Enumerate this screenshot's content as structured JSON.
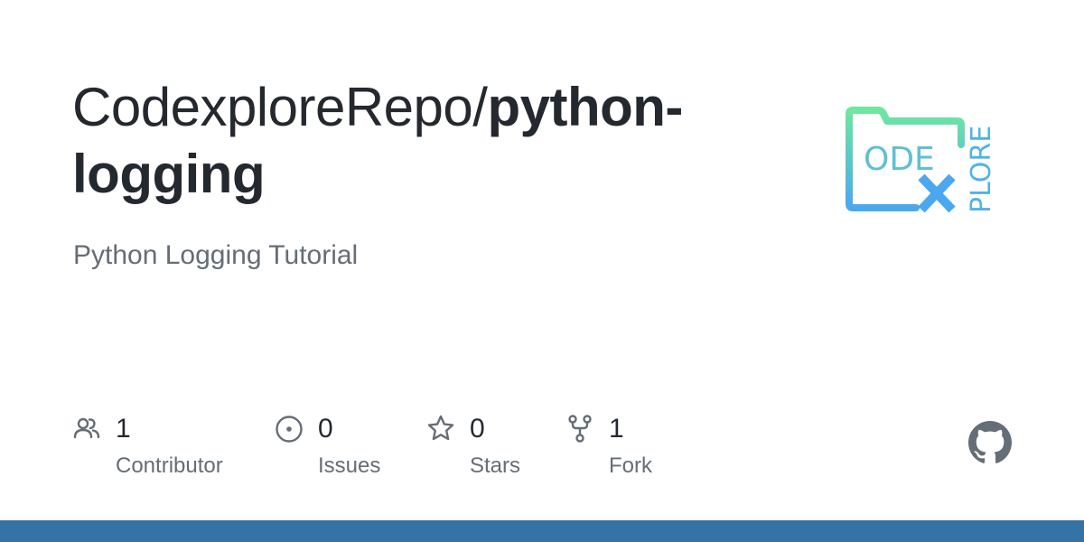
{
  "repo": {
    "owner": "CodexploreRepo/",
    "name": "python-logging",
    "description": "Python Logging Tutorial"
  },
  "logo": {
    "text_main": "ODE",
    "text_vertical": "PLORE",
    "letter_x": "X",
    "gradient_top": "#6ee7a0",
    "gradient_bottom": "#4aa8f0"
  },
  "stats": [
    {
      "icon": "people-icon",
      "count": "1",
      "label": "Contributor"
    },
    {
      "icon": "issue-icon",
      "count": "0",
      "label": "Issues"
    },
    {
      "icon": "star-icon",
      "count": "0",
      "label": "Stars"
    },
    {
      "icon": "fork-icon",
      "count": "1",
      "label": "Fork"
    }
  ],
  "colors": {
    "title": "#24292f",
    "muted": "#656d76",
    "footer_bar": "#3572a5",
    "icon": "#656d76"
  }
}
